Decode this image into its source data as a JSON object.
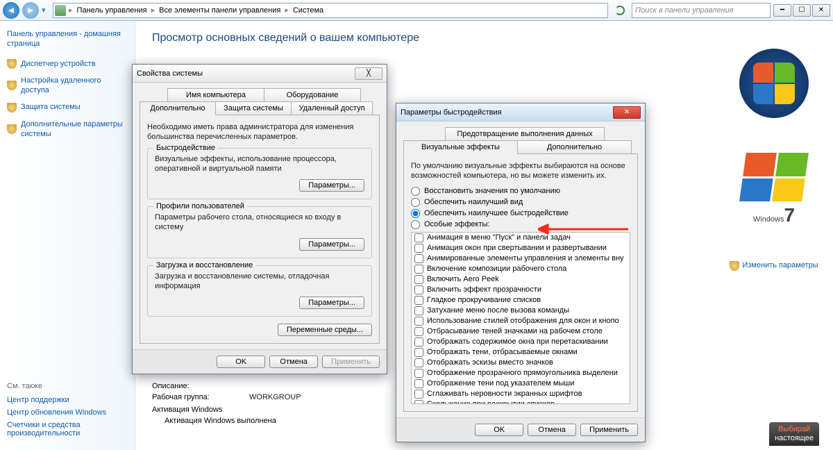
{
  "nav": {
    "breadcrumb": [
      "Панель управления",
      "Все элементы панели управления",
      "Система"
    ],
    "search_placeholder": "Поиск в панели управления"
  },
  "sidebar": {
    "title": "Панель управления - домашняя страница",
    "links": [
      "Диспетчер устройств",
      "Настройка удаленного доступа",
      "Защита системы",
      "Дополнительные параметры системы"
    ],
    "see_also": "См. также",
    "footer_links": [
      "Центр поддержки",
      "Центр обновления Windows",
      "Счетчики и средства производительности"
    ]
  },
  "content": {
    "page_title": "Просмотр основных сведений о вашем компьютере",
    "desc_label": "Описание:",
    "workgroup_label": "Рабочая группа:",
    "workgroup_value": "WORKGROUP",
    "activation_section": "Активация Windows",
    "activation_status": "Активация Windows выполнена",
    "change_params": "Изменить параметры",
    "win7_label": "Windows",
    "win7_num": "7"
  },
  "dlg1": {
    "title": "Свойства системы",
    "tabs_row1": [
      "Имя компьютера",
      "Оборудование"
    ],
    "tabs_row2": [
      "Дополнительно",
      "Защита системы",
      "Удаленный доступ"
    ],
    "intro": "Необходимо иметь права администратора для изменения большинства перечисленных параметров.",
    "g1_title": "Быстродействие",
    "g1_desc": "Визуальные эффекты, использование процессора, оперативной и виртуальной памяти",
    "g2_title": "Профили пользователей",
    "g2_desc": "Параметры рабочего стола, относящиеся ко входу в систему",
    "g3_title": "Загрузка и восстановление",
    "g3_desc": "Загрузка и восстановление системы, отладочная информация",
    "params_btn": "Параметры...",
    "env_btn": "Переменные среды...",
    "ok": "OK",
    "cancel": "Отмена",
    "apply": "Применить"
  },
  "dlg2": {
    "title": "Параметры быстродействия",
    "tabs_row1": [
      "Предотвращение выполнения данных"
    ],
    "tabs_row2": [
      "Визуальные эффекты",
      "Дополнительно"
    ],
    "intro": "По умолчанию визуальные эффекты выбираются на основе возможностей компьютера, но вы можете изменить их.",
    "radios": [
      "Восстановить значения по умолчанию",
      "Обеспечить наилучший вид",
      "Обеспечить наилучшее быстродействие",
      "Особые эффекты:"
    ],
    "radio_selected": 2,
    "checks": [
      "Анимация в меню \"Пуск\" и панели задач",
      "Анимация окон при свертывании и развертывании",
      "Анимированные элементы управления и элементы вну",
      "Включение композиции рабочего стола",
      "Включить Aero Peek",
      "Включить эффект прозрачности",
      "Гладкое прокручивание списков",
      "Затухание меню после вызова команды",
      "Использование стилей отображения для окон и кнопо",
      "Отбрасывание теней значками на рабочем столе",
      "Отображать содержимое окна при перетаскивании",
      "Отображать тени, отбрасываемые окнами",
      "Отображать эскизы вместо значков",
      "Отображение прозрачного прямоугольника выделени",
      "Отображение тени под указателем мыши",
      "Сглаживать неровности экранных шрифтов",
      "Скольжение при раскрытии списков"
    ],
    "ok": "OK",
    "cancel": "Отмена",
    "apply": "Применить"
  },
  "promo": {
    "l1": "Выбирай",
    "l2": "настоящее"
  }
}
